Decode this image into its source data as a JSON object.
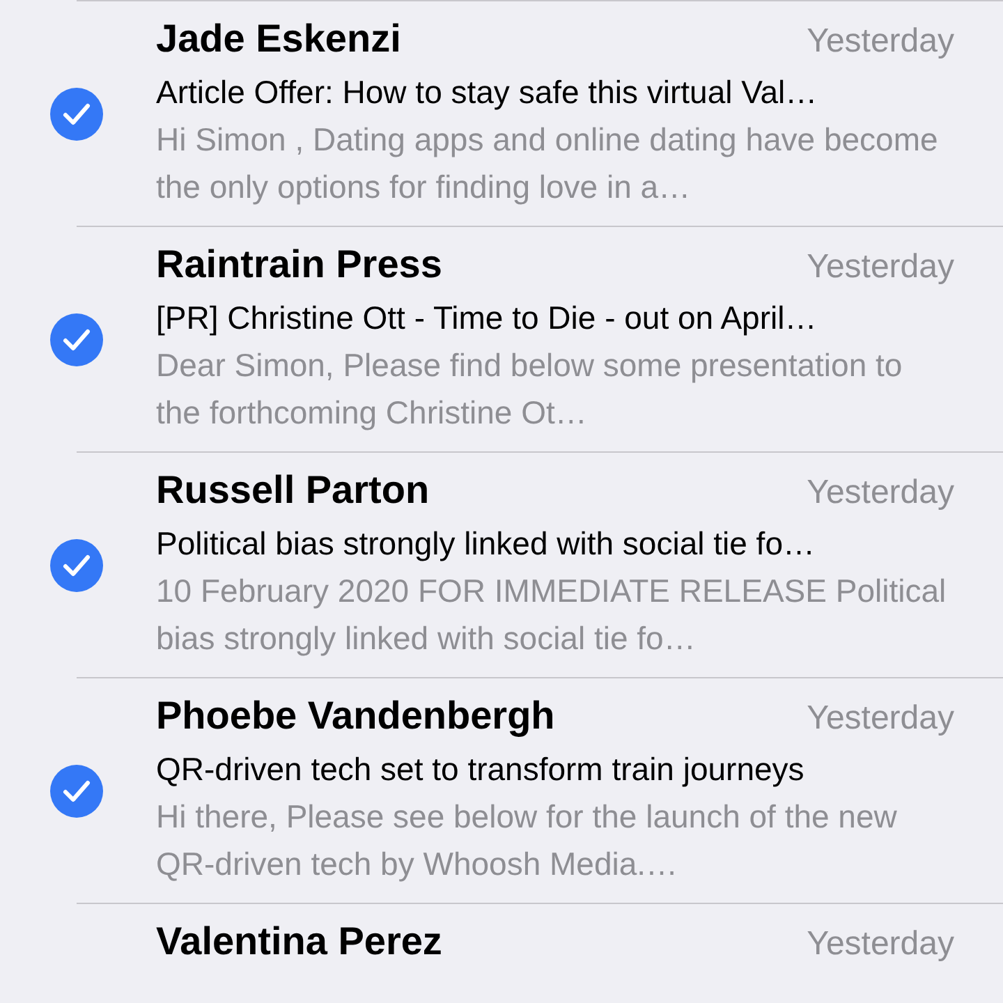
{
  "emails": [
    {
      "sender": "Jade Eskenzi",
      "date": "Yesterday",
      "subject": "Article Offer: How to stay safe this virtual Val…",
      "preview": "Hi Simon , Dating apps and online dating have become the only options for finding love in a…",
      "checked": true
    },
    {
      "sender": "Raintrain Press",
      "date": "Yesterday",
      "subject": "[PR] Christine Ott - Time to Die - out on April…",
      "preview": "Dear Simon, Please find below some presentation to the forthcoming Christine Ot…",
      "checked": true
    },
    {
      "sender": "Russell Parton",
      "date": "Yesterday",
      "subject": "Political bias strongly linked with social tie fo…",
      "preview": "10 February 2020 FOR IMMEDIATE RELEASE Political bias strongly linked with social tie fo…",
      "checked": true
    },
    {
      "sender": "Phoebe Vandenbergh",
      "date": "Yesterday",
      "subject": "QR-driven tech set to transform train journeys",
      "preview": "Hi there, Please see below for the launch of the new QR-driven tech by Whoosh Media.…",
      "checked": true
    },
    {
      "sender": "Valentina Perez",
      "date": "Yesterday"
    }
  ]
}
